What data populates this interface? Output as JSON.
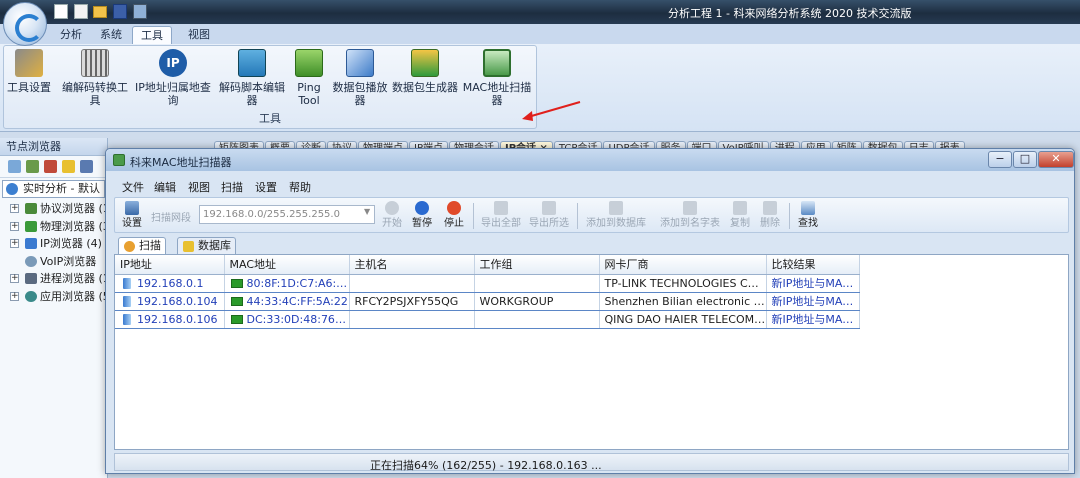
{
  "window": {
    "title": "分析工程 1 - 科来网络分析系统 2020 技术交流版"
  },
  "ribbon": {
    "tabs": [
      "分析",
      "系统",
      "工具",
      "视图"
    ],
    "active_tab": "工具",
    "group_label": "工具",
    "buttons": [
      {
        "label": "工具设置",
        "icon": "tools-settings-icon"
      },
      {
        "label": "编解码转换工具",
        "icon": "codec-converter-icon"
      },
      {
        "label": "IP地址归属地查询",
        "icon": "ip-lookup-icon"
      },
      {
        "label": "解码脚本编辑器",
        "icon": "decode-script-icon"
      },
      {
        "label": "Ping\nTool",
        "icon": "ping-tool-icon"
      },
      {
        "label": "数据包播放器",
        "icon": "packet-player-icon"
      },
      {
        "label": "数据包生成器",
        "icon": "packet-generator-icon"
      },
      {
        "label": "MAC地址扫描器",
        "icon": "mac-scanner-icon"
      }
    ],
    "ping_label_line1": "Ping",
    "ping_label_line2": "Tool"
  },
  "node_browser": {
    "title": "节点浏览器",
    "combo_value": "实时分析 - 默认",
    "items": [
      {
        "label": "协议浏览器 (1",
        "icon": "protocol-browser-icon"
      },
      {
        "label": "物理浏览器 (3",
        "icon": "physical-browser-icon"
      },
      {
        "label": "IP浏览器 (4)",
        "icon": "ip-browser-icon"
      },
      {
        "label": "VoIP浏览器",
        "icon": "voip-browser-icon"
      },
      {
        "label": "进程浏览器 (1",
        "icon": "process-browser-icon"
      },
      {
        "label": "应用浏览器 (5",
        "icon": "app-browser-icon"
      }
    ]
  },
  "background_tabs": [
    "矩阵图表",
    "概要",
    "诊断",
    "协议",
    "物理端点",
    "IP端点",
    "物理会话",
    "IP会话 ×",
    "TCP会话",
    "UDP会话",
    "服务",
    "端口",
    "VoIP呼叫",
    "进程",
    "应用",
    "矩阵",
    "数据包",
    "日志",
    "报表"
  ],
  "dialog": {
    "title": "科来MAC地址扫描器",
    "menu": [
      "文件",
      "编辑",
      "视图",
      "扫描",
      "设置",
      "帮助"
    ],
    "toolbar": {
      "settings": "设置",
      "scan_label": "扫描网段",
      "scan_range": "192.168.0.0/255.255.255.0",
      "start": "开始",
      "pause": "暂停",
      "stop": "停止",
      "export_all": "导出全部",
      "export_selected": "导出所选",
      "add_to_db": "添加到数据库",
      "add_to_dict": "添加到名字表",
      "copy": "复制",
      "delete": "删除",
      "find": "查找"
    },
    "tabs": [
      "扫描",
      "数据库"
    ],
    "columns": [
      "IP地址",
      "MAC地址",
      "主机名",
      "工作组",
      "网卡厂商",
      "比较结果"
    ],
    "rows": [
      {
        "ip": "192.168.0.1",
        "mac": "80:8F:1D:C7:A6:07",
        "host": "",
        "group": "",
        "vendor": "TP-LINK TECHNOLOGIES CO.,...",
        "result": "新IP地址与MAC地址"
      },
      {
        "ip": "192.168.0.104",
        "mac": "44:33:4C:FF:5A:22",
        "host": "RFCY2PSJXFY55QG",
        "group": "WORKGROUP",
        "vendor": "Shenzhen Bilian electronic CO.,...",
        "result": "新IP地址与MAC地址"
      },
      {
        "ip": "192.168.0.106",
        "mac": "DC:33:0D:48:76:C5",
        "host": "",
        "group": "",
        "vendor": "QING DAO HAIER TELECOM C...",
        "result": "新IP地址与MAC地址"
      }
    ],
    "status": "正在扫描64% (162/255) - 192.168.0.163 ..."
  },
  "colors": {
    "accent": "#2340b8",
    "row_border": "#5b86c6",
    "arrow": "#e0201c"
  }
}
